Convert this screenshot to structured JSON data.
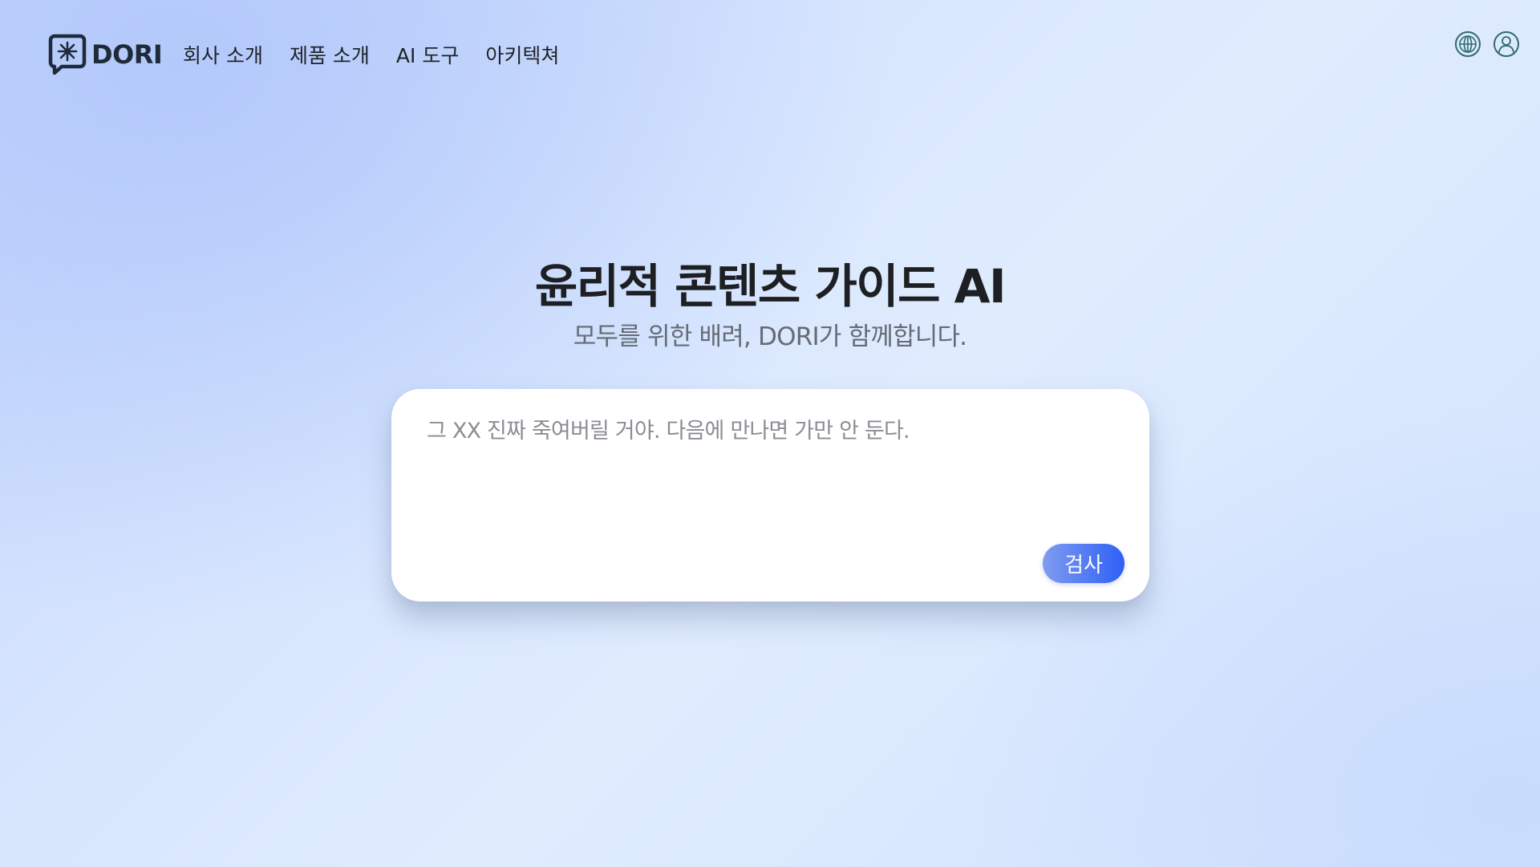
{
  "brand": {
    "name": "DORI",
    "logo_icon": "chat-bubble-star-icon"
  },
  "nav": {
    "items": [
      {
        "label": "회사 소개"
      },
      {
        "label": "제품 소개"
      },
      {
        "label": "AI 도구"
      },
      {
        "label": "아키텍쳐"
      }
    ]
  },
  "header_icons": {
    "language_icon": "globe-icon",
    "account_icon": "user-icon",
    "icon_color": "#2f6b6e"
  },
  "hero": {
    "title": "윤리적 콘텐츠 가이드 AI",
    "subtitle": "모두를 위한 배려, DORI가 함께합니다."
  },
  "input": {
    "value": "그 XX 진짜 죽여버릴 거야. 다음에 만나면 가만 안 둔다.",
    "submit_label": "검사"
  },
  "colors": {
    "accent": "#2f5ff6",
    "accent_light": "#7f9cf0",
    "background_light": "#dfecfe",
    "background_dark": "#b3c9fb"
  }
}
